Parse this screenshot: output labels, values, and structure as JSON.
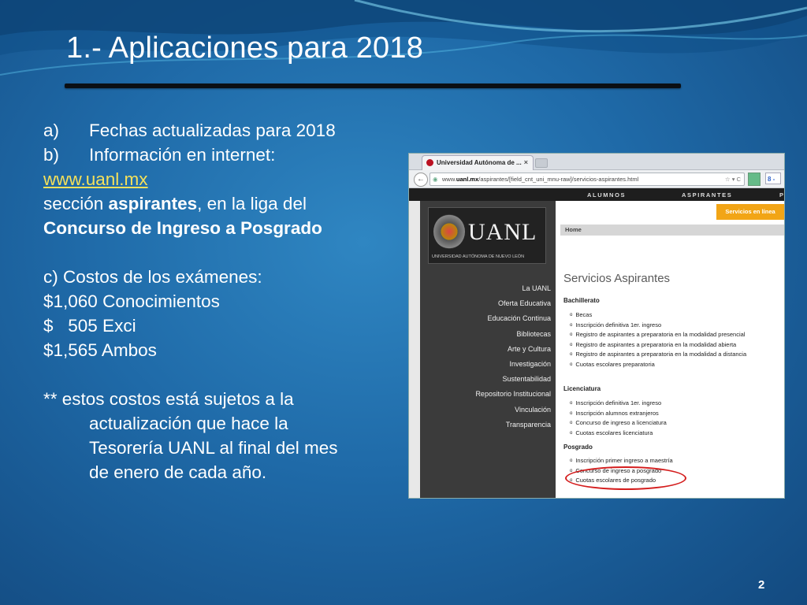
{
  "slide": {
    "title": "1.- Aplicaciones para 2018",
    "page_number": "2",
    "items": {
      "a_label": "a)",
      "a_text": "Fechas actualizadas para 2018",
      "b_label": "b)",
      "b_text": "Información en internet:",
      "link": "www.uanl.mx",
      "section_prefix": "sección ",
      "section_bold": "aspirantes",
      "section_suffix": ", en la liga del",
      "contest_bold": "Concurso de Ingreso a Posgrado",
      "c_text": "c)  Costos de los exámenes:",
      "cost1": "$1,060 Conocimientos",
      "cost2": "$   505 Exci",
      "cost3": "$1,565 Ambos",
      "note_line1": "** estos costos está sujetos a la",
      "note_line2": "actualización que hace la",
      "note_line3": "Tesorería UANL al final del mes",
      "note_line4": "de enero de cada año."
    }
  },
  "browser": {
    "tab_title": "Universidad Autónoma de ...",
    "tab_close": "×",
    "back_glyph": "←",
    "url_prefix": "www.",
    "url_domain": "uanl.mx",
    "url_path": "/aspirantes/[field_cnt_uni_mnu-raw]/servicios-aspirantes.html",
    "url_actions": "☆ ▾ C",
    "search_ext": "8 -"
  },
  "site": {
    "topnav": [
      "ALUMNOS",
      "ASPIRANTES",
      "P"
    ],
    "logo_word": "UANL",
    "logo_sub": "UNIVERSIDAD AUTÓNOMA DE NUEVO LEÓN",
    "menu": [
      "La UANL",
      "Oferta Educativa",
      "Educación Continua",
      "Bibliotecas",
      "Arte y Cultura",
      "Investigación",
      "Sustentabilidad",
      "Repositorio Institucional",
      "Vinculación",
      "Transparencia"
    ],
    "online_button": "Servicios en línea",
    "breadcrumb": "Home",
    "page_title": "Servicios Aspirantes",
    "sections": [
      {
        "heading": "Bachillerato",
        "items": [
          "Becas",
          "Inscripción definitiva 1er. ingreso",
          "Registro de aspirantes a preparatoria en la modalidad presencial",
          "Registro de aspirantes a preparatoria en la modalidad abierta",
          "Registro de aspirantes a preparatoria en la modalidad a distancia",
          "Cuotas escolares preparatoria"
        ]
      },
      {
        "heading": "Licenciatura",
        "items": [
          "Inscripción definitiva 1er. ingreso",
          "Inscripción alumnos extranjeros",
          "Concurso de ingreso a licenciatura",
          "Cuotas escolares licenciatura"
        ]
      },
      {
        "heading": "Posgrado",
        "items": [
          "Inscripción primer ingreso a maestría",
          "Concurso de ingreso a posgrado",
          "Cuotas escolares de posgrado"
        ]
      }
    ]
  },
  "colors": {
    "accent_orange": "#f2a516",
    "highlight_red": "#d41d1d",
    "link_yellow": "#f5e15a"
  }
}
